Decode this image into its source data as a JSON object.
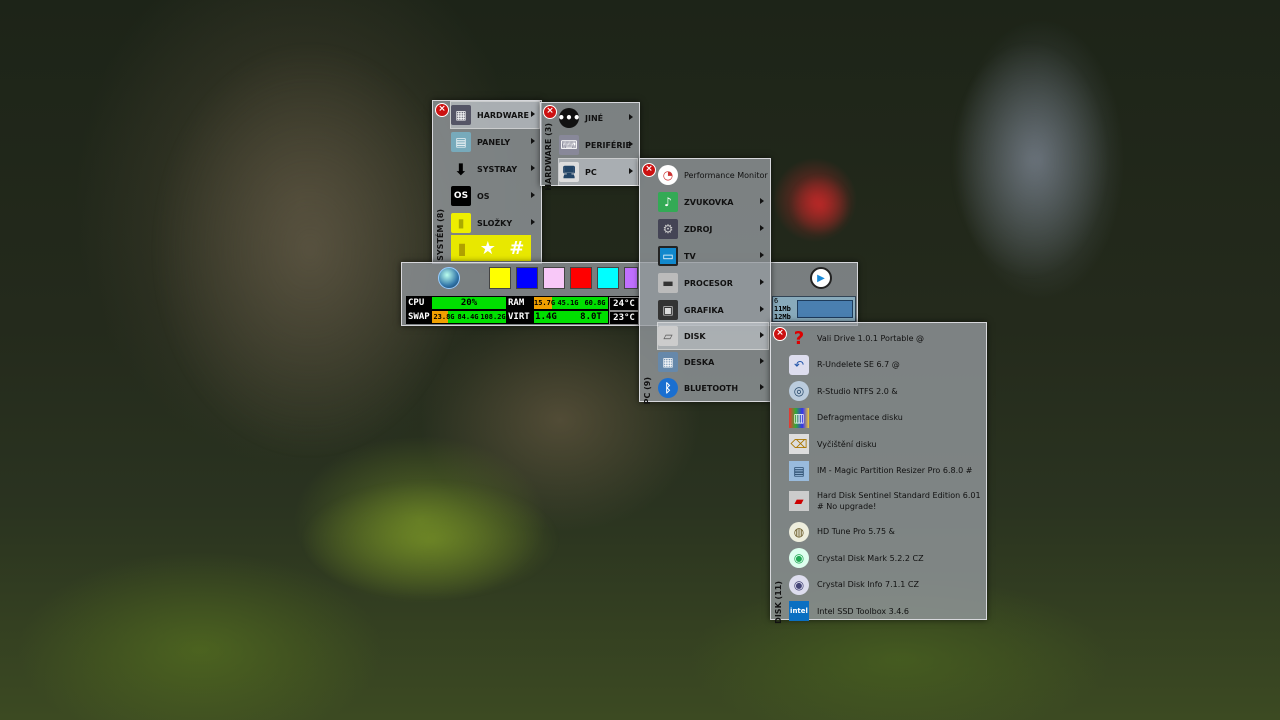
{
  "colors": {
    "swatches": [
      "#ffff00",
      "#0000ff",
      "#f8c8f8",
      "#ff0000",
      "#00ffff",
      "#c070ff"
    ],
    "cpu_bar": "#00e000",
    "ram_bar": "#00e000",
    "warn": "#f0a000"
  },
  "system_panel": {
    "title": "SYSTÉM (8)",
    "items": [
      {
        "label": "HARDWARE",
        "icon": "hardware-icon"
      },
      {
        "label": "PANELY",
        "icon": "panels-icon"
      },
      {
        "label": "SYSTRAY",
        "icon": "systray-icon"
      },
      {
        "label": "OS",
        "icon": "os-icon"
      },
      {
        "label": "SLOŽKY",
        "icon": "folder-icon"
      }
    ],
    "bottom_icons": [
      "folder-icon",
      "star-icon",
      "hash-icon"
    ]
  },
  "hardware_panel": {
    "title": "HARDWARE (3)",
    "items": [
      {
        "label": "JINÉ",
        "icon": "more-icon"
      },
      {
        "label": "PERIFÉRIE",
        "icon": "peripherals-icon"
      },
      {
        "label": "PC",
        "icon": "pc-icon"
      }
    ]
  },
  "pc_panel": {
    "title": "PC (9)",
    "items": [
      {
        "label": "Performance Monitor",
        "icon": "performance-monitor-icon"
      },
      {
        "label": "ZVUKOVKA",
        "icon": "sound-card-icon"
      },
      {
        "label": "ZDROJ",
        "icon": "power-supply-icon"
      },
      {
        "label": "TV",
        "icon": "tv-icon"
      },
      {
        "label": "PROCESOR",
        "icon": "cpu-icon"
      },
      {
        "label": "GRAFIKA",
        "icon": "graphics-card-icon"
      },
      {
        "label": "DISK",
        "icon": "disk-icon"
      },
      {
        "label": "DESKA",
        "icon": "motherboard-icon"
      },
      {
        "label": "BLUETOOTH",
        "icon": "bluetooth-icon"
      }
    ]
  },
  "disk_panel": {
    "title": "DISK (11)",
    "items": [
      {
        "label": "Vali Drive 1.0.1 Portable @",
        "icon": "help-icon"
      },
      {
        "label": "R-Undelete SE 6.7 @",
        "icon": "undelete-icon"
      },
      {
        "label": "R-Studio NTFS 2.0 &",
        "icon": "r-studio-icon"
      },
      {
        "label": "Defragmentace disku",
        "icon": "defrag-icon"
      },
      {
        "label": "Vyčištění disku",
        "icon": "disk-cleanup-icon"
      },
      {
        "label": "IM - Magic Partition Resizer Pro 6.8.0 #",
        "icon": "partition-icon"
      },
      {
        "label": "Hard Disk Sentinel Standard Edition 6.01 # No upgrade!",
        "icon": "hdd-sentinel-icon"
      },
      {
        "label": "HD Tune Pro 5.75 &",
        "icon": "hd-tune-icon"
      },
      {
        "label": "Crystal Disk Mark 5.2.2 CZ",
        "icon": "crystal-disk-mark-icon"
      },
      {
        "label": "Crystal Disk Info 7.1.1 CZ",
        "icon": "crystal-disk-info-icon"
      },
      {
        "label": "Intel SSD Toolbox 3.4.6",
        "icon": "intel-icon"
      }
    ]
  },
  "stats": {
    "cpu_label": "CPU",
    "cpu_percent": "20%",
    "cpu_fraction": 0.2,
    "ram_label": "RAM",
    "ram_used": "15.7G",
    "ram_free": "45.1G",
    "ram_total": "60.8G",
    "ram_temp": "24°C",
    "swap_label": "SWAP",
    "swap_a": "23.8G",
    "swap_b": "84.4G",
    "swap_c": "108.2G",
    "virt_label": "VIRT",
    "virt_a": "1.4G",
    "virt_b": "8.0T",
    "virt_temp": "23°C"
  },
  "net_meter": {
    "line1": "6",
    "line2": "11Mb",
    "line3": "12Mb"
  }
}
